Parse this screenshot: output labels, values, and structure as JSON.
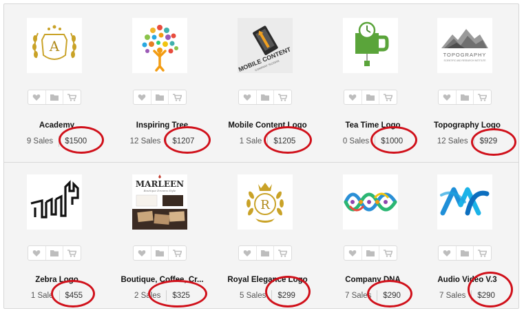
{
  "items": [
    {
      "title": "Academy",
      "sales": "9 Sales",
      "price": "$1500",
      "logo": "academy-logo-icon"
    },
    {
      "title": "Inspiring Tree",
      "sales": "12 Sales",
      "price": "$1207",
      "logo": "inspiring-tree-logo-icon"
    },
    {
      "title": "Mobile Content Logo",
      "sales": "1 Sale",
      "price": "$1205",
      "logo": "mobile-content-logo-icon",
      "thumb_text": "MOBILE CONTENT",
      "thumb_subtext": "COMPANY SLOGAN"
    },
    {
      "title": "Tea Time Logo",
      "sales": "0 Sales",
      "price": "$1000",
      "logo": "tea-time-logo-icon"
    },
    {
      "title": "Topography Logo",
      "sales": "12 Sales",
      "price": "$929",
      "logo": "topography-logo-icon",
      "thumb_text": "TOPOGRAPHY",
      "thumb_subtext": "SCIENTIFIC AND RESEARCH INSTITUTE"
    },
    {
      "title": "Zebra Logo",
      "sales": "1 Sale",
      "price": "$455",
      "logo": "zebra-logo-icon"
    },
    {
      "title": "Boutique, Coffee, Cr...",
      "sales": "2 Sales",
      "price": "$325",
      "logo": "marleen-logo-icon",
      "thumb_text": "MARLEEN",
      "thumb_subtext": "Boutique Dreams Style"
    },
    {
      "title": "Royal Elegance Logo",
      "sales": "5 Sales",
      "price": "$299",
      "logo": "royal-elegance-logo-icon",
      "thumb_text": "R"
    },
    {
      "title": "Company DNA",
      "sales": "7 Sales",
      "price": "$290",
      "logo": "company-dna-logo-icon"
    },
    {
      "title": "Audio Video V.3",
      "sales": "7 Sales",
      "price": "$290",
      "logo": "audio-video-logo-icon"
    }
  ],
  "colors": {
    "annotation": "#d0101a",
    "gold": "#c9a227",
    "tea_green": "#5aa43a"
  }
}
